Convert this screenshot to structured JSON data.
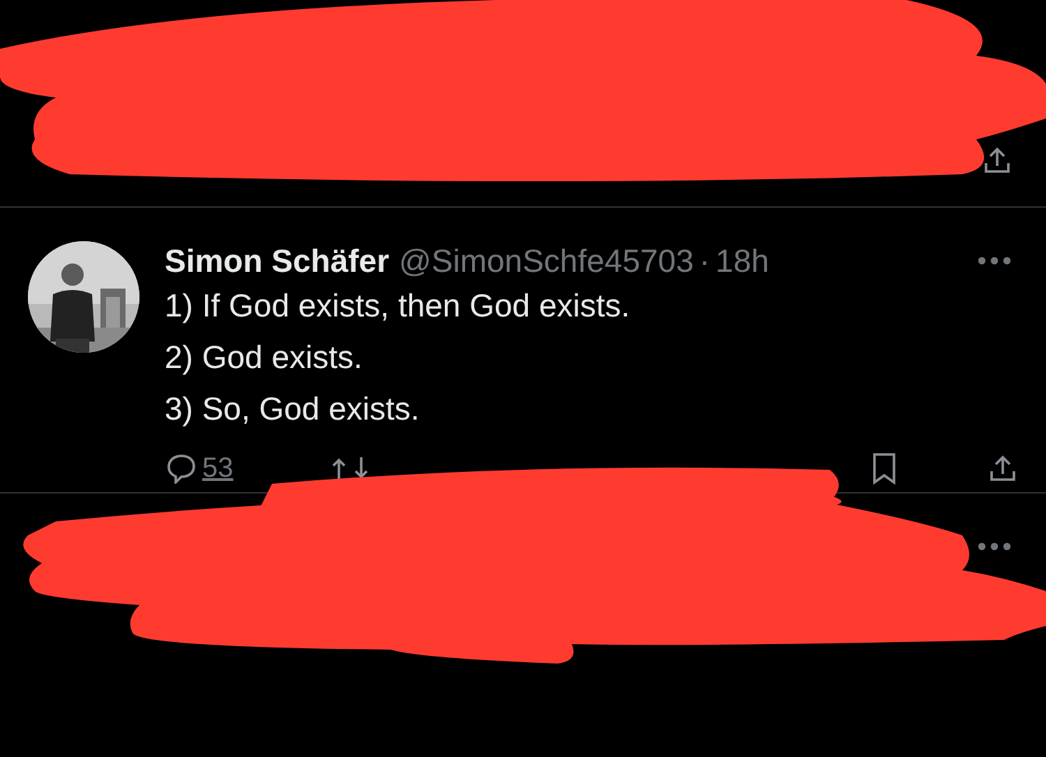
{
  "tweets": [
    {
      "kind": "redacted-footer"
    },
    {
      "kind": "post",
      "name": "Simon Schäfer",
      "handle": "@SimonSchfe45703",
      "separator": "·",
      "time": "18h",
      "lines": [
        "1) If God exists, then God exists.",
        "2) God exists.",
        "3) So, God exists."
      ],
      "replies": "53"
    },
    {
      "kind": "redacted-header"
    }
  ]
}
